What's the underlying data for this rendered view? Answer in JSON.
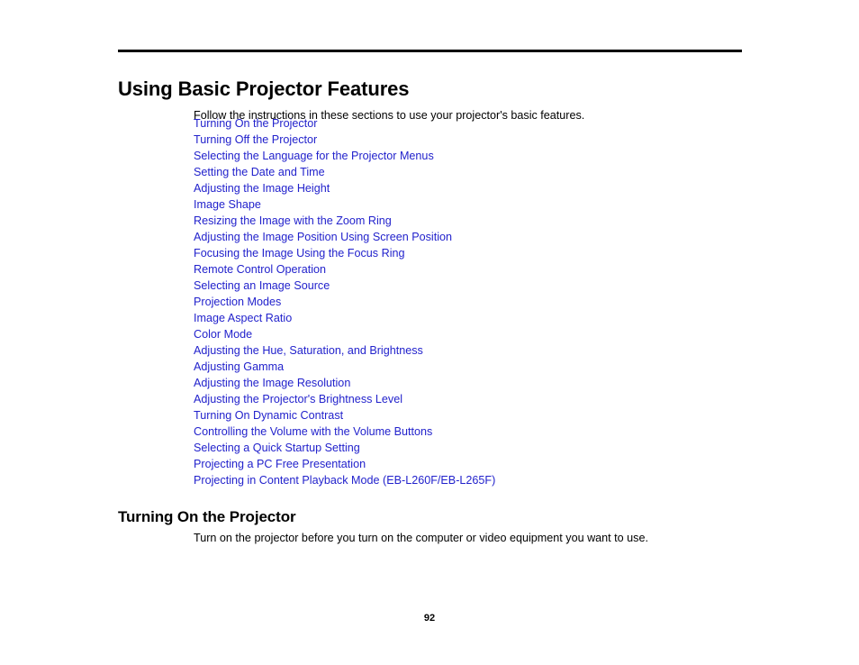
{
  "document": {
    "chapter_title": "Using Basic Projector Features",
    "intro_paragraph": "Follow the instructions in these sections to use your projector's basic features.",
    "toc_links": [
      {
        "label": "Turning On the Projector"
      },
      {
        "label": "Turning Off the Projector"
      },
      {
        "label": "Selecting the Language for the Projector Menus"
      },
      {
        "label": "Setting the Date and Time"
      },
      {
        "label": "Adjusting the Image Height"
      },
      {
        "label": "Image Shape"
      },
      {
        "label": "Resizing the Image with the Zoom Ring"
      },
      {
        "label": "Adjusting the Image Position Using Screen Position"
      },
      {
        "label": "Focusing the Image Using the Focus Ring"
      },
      {
        "label": "Remote Control Operation"
      },
      {
        "label": "Selecting an Image Source"
      },
      {
        "label": "Projection Modes"
      },
      {
        "label": "Image Aspect Ratio"
      },
      {
        "label": "Color Mode"
      },
      {
        "label": "Adjusting the Hue, Saturation, and Brightness"
      },
      {
        "label": "Adjusting Gamma"
      },
      {
        "label": "Adjusting the Image Resolution"
      },
      {
        "label": "Adjusting the Projector's Brightness Level"
      },
      {
        "label": "Turning On Dynamic Contrast"
      },
      {
        "label": "Controlling the Volume with the Volume Buttons"
      },
      {
        "label": "Selecting a Quick Startup Setting"
      },
      {
        "label": "Projecting a PC Free Presentation"
      },
      {
        "label": "Projecting in Content Playback Mode (EB-L260F/EB-L265F)"
      }
    ],
    "section": {
      "heading": "Turning On the Projector",
      "paragraph": "Turn on the projector before you turn on the computer or video equipment you want to use."
    },
    "page_number": "92",
    "colors": {
      "link": "#2222CC",
      "text": "#000000",
      "background": "#FFFFFF",
      "rule": "#000000"
    }
  }
}
